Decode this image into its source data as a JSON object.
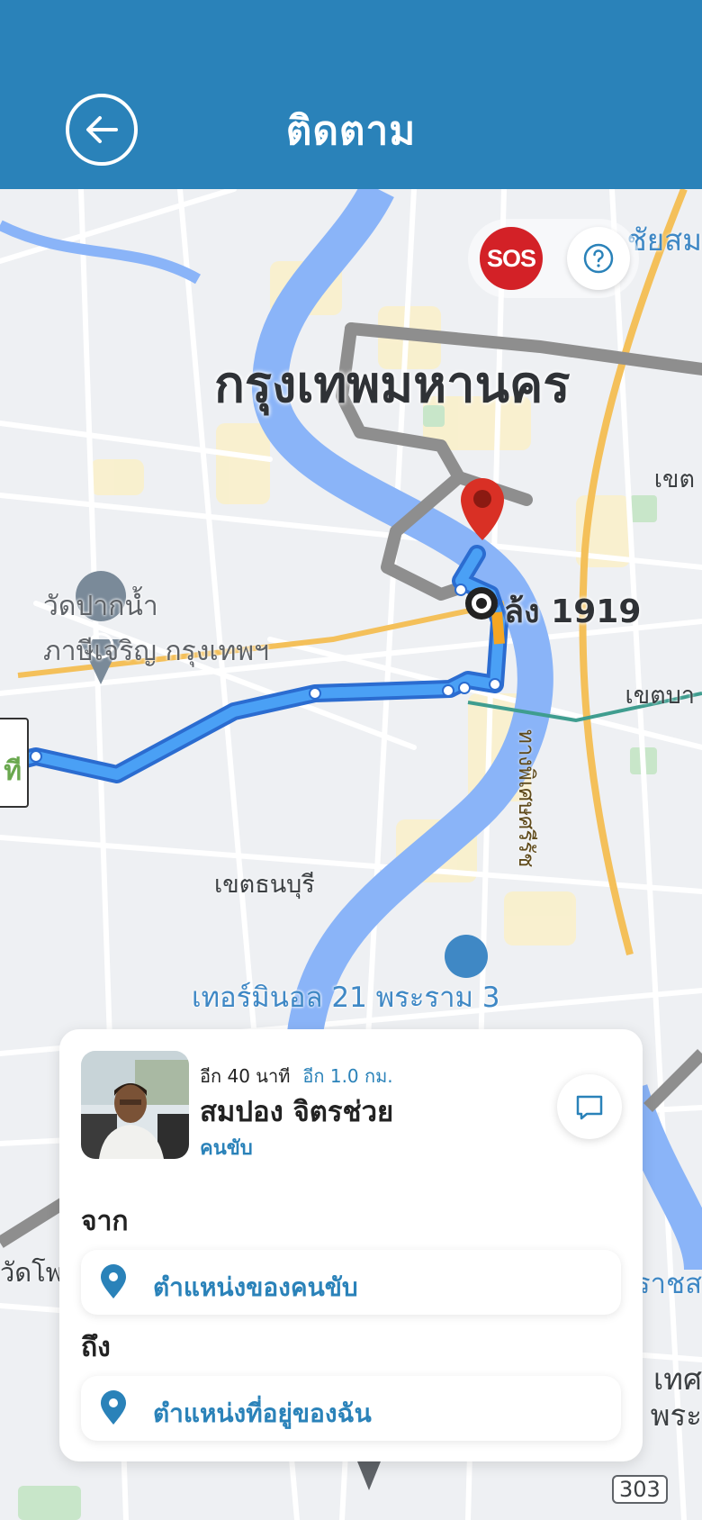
{
  "header": {
    "title": "ติดตาม",
    "back_icon": "arrow-left-icon"
  },
  "map": {
    "city_label": "กรุงเทพมหานคร",
    "poi_line1": "วัดปากน้ำ",
    "poi_line2": "ภาษีเจริญ กรุงเทพฯ",
    "district_label": "เขตธนบุรี",
    "terminal_label": "เทอร์มินอล 21 พระราม 3",
    "destination_label": "ล้ง 1919",
    "road_label_a": "เขต",
    "road_label_b": "เขตบา",
    "edge_top_right": "ชัยสม",
    "edge_right_mid": "ราชส",
    "edge_left": "วัดโพ",
    "edge_bottom_right_1": "เทศ",
    "edge_bottom_right_2": "พระ",
    "vertical_road": "ทางพิเศษศรีรัช",
    "route_shield": "303",
    "left_callout_text": "ที",
    "colors": {
      "route": "#3b8ef0",
      "river": "#8ab4f8",
      "pin": "#d93025"
    }
  },
  "fab": {
    "sos_label": "SOS",
    "help_icon": "question-circle-icon"
  },
  "card": {
    "eta_time": "อีก 40 นาที",
    "eta_distance": "อีก 1.0 กม.",
    "driver_name": "สมปอง จิตรช่วย",
    "driver_role": "คนขับ",
    "chat_icon": "chat-bubble-icon",
    "from_label": "จาก",
    "from_value": "ตำแหน่งของคนขับ",
    "to_label": "ถึง",
    "to_value": "ตำแหน่งที่อยู่ของฉัน"
  },
  "colors": {
    "primary": "#2a82b9",
    "sos": "#d32127"
  }
}
